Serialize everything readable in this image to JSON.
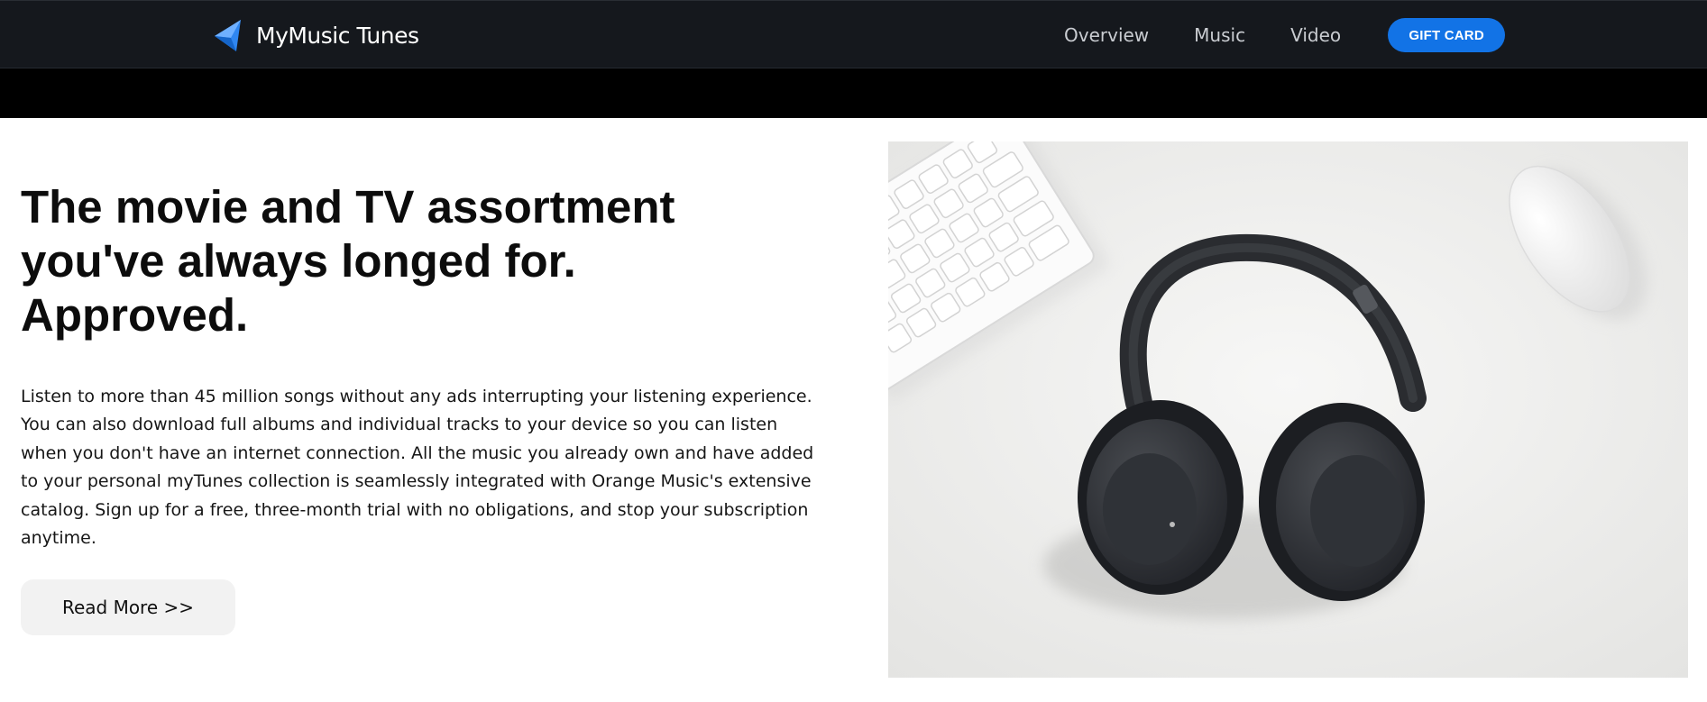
{
  "header": {
    "brand_name": "MyMusic Tunes",
    "logo_icon": "triangle-logo-icon",
    "nav": [
      {
        "label": "Overview"
      },
      {
        "label": "Music"
      },
      {
        "label": "Video"
      }
    ],
    "gift_card_label": "GIFT CARD"
  },
  "hero": {
    "title_lines": [
      "The movie and TV assortment",
      "you've always longed for.",
      "Approved."
    ],
    "body_lines": [
      "Listen to more than 45 million songs without any ads interrupting your listening experience.",
      "You can also download full albums and individual tracks to your device so you can listen",
      "when you don't have an internet connection. All the music you already own and have added",
      "to your personal myTunes collection is seamlessly integrated with Orange Music's extensive",
      "catalog. Sign up for a free, three-month trial with no obligations, and stop your subscription",
      "anytime."
    ],
    "read_more_label": "Read More >>",
    "image_subject": "headphones-keyboard-mouse-photo"
  },
  "colors": {
    "header_bg": "#15181d",
    "accent": "#1273e6",
    "logo_blue": "#2f86f0",
    "band": "#000000"
  }
}
